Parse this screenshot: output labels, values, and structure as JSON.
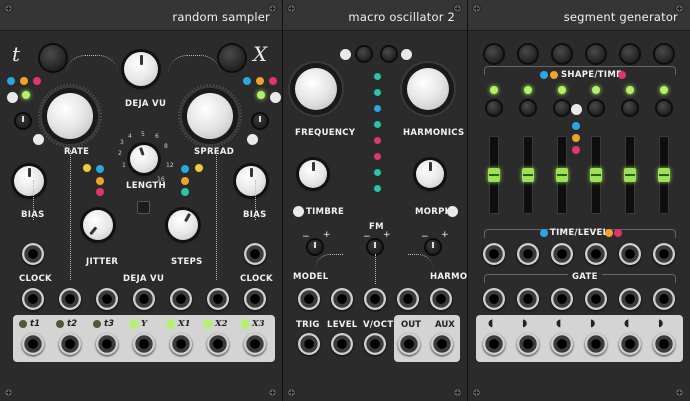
{
  "modules": {
    "random_sampler": {
      "title": "random sampler",
      "t_label": "t",
      "x_label": "X",
      "knobs": {
        "rate": "RATE",
        "deja_vu": "DEJA VU",
        "spread": "SPREAD",
        "length": "LENGTH",
        "bias_left": "BIAS",
        "bias_right": "BIAS",
        "jitter": "JITTER",
        "steps": "STEPS"
      },
      "length_ticks": [
        "1",
        "2",
        "3",
        "4",
        "5",
        "6",
        "8",
        "12",
        "16"
      ],
      "jacks": {
        "clock_left": "CLOCK",
        "deja_vu": "DEJA VU",
        "clock_right": "CLOCK"
      },
      "outputs": [
        "t1",
        "t2",
        "t3",
        "Y",
        "X1",
        "X2",
        "X3"
      ]
    },
    "macro_oscillator": {
      "title": "macro oscillator 2",
      "knobs": {
        "frequency": "FREQUENCY",
        "harmonics": "HARMONICS",
        "timbre": "TIMBRE",
        "morph": "MORPH",
        "fm": "FM"
      },
      "jacks": {
        "model": "MODEL",
        "harmo": "HARMO",
        "trig": "TRIG",
        "level": "LEVEL",
        "voct": "V/OCT"
      },
      "outputs": {
        "out": "OUT",
        "aux": "AUX"
      },
      "attenuverter_minus": "−",
      "attenuverter_plus": "+"
    },
    "segment_generator": {
      "title": "segment generator",
      "shape_time": "SHAPE/TIME",
      "time_level": "TIME/LEVEL",
      "gate": "GATE"
    }
  },
  "colors": {
    "panel": "#2b2b2b",
    "led_on": "#b6f06a",
    "accent_blue": "#2aa7e0",
    "accent_orange": "#f2a12a",
    "accent_red": "#e2356a",
    "accent_teal": "#2cc3a8"
  }
}
